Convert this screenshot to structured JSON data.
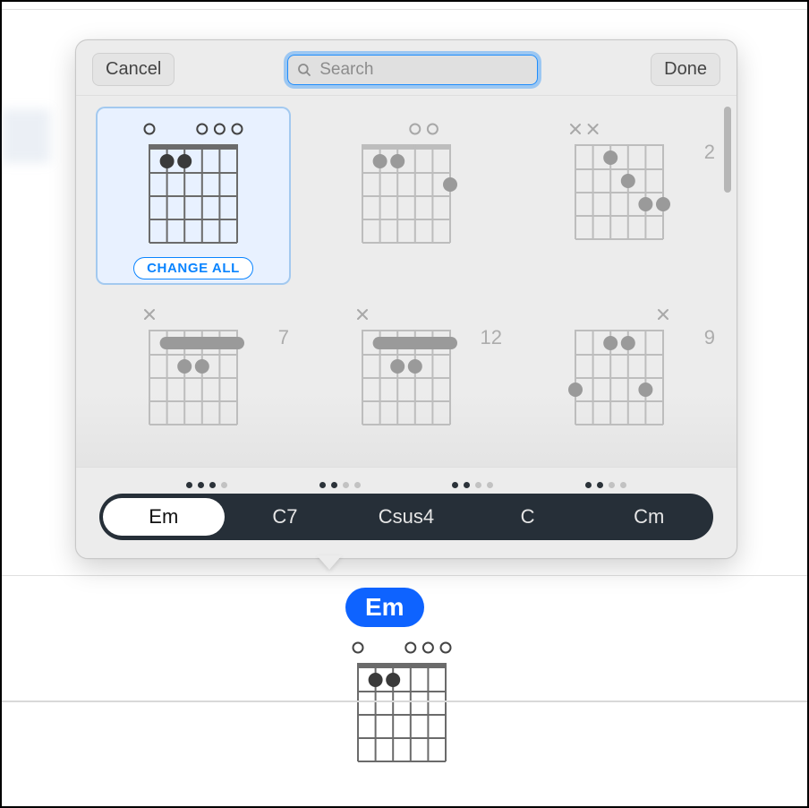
{
  "header": {
    "cancel": "Cancel",
    "done": "Done",
    "search_placeholder": "Search",
    "search_value": ""
  },
  "grid": {
    "items": [
      {
        "selected": true,
        "change_all_label": "CHANGE ALL",
        "muted": [],
        "open": [
          0,
          3,
          4,
          5
        ],
        "dots": [
          [
            1,
            1
          ],
          [
            1,
            2
          ]
        ],
        "barre": null,
        "fret_label": ""
      },
      {
        "selected": false,
        "muted": [],
        "open": [
          3,
          4
        ],
        "dots": [
          [
            1,
            1
          ],
          [
            1,
            2
          ],
          [
            2,
            5
          ]
        ],
        "barre": null,
        "fret_label": ""
      },
      {
        "selected": false,
        "muted": [
          0,
          1
        ],
        "open": [],
        "dots": [
          [
            1,
            2
          ],
          [
            2,
            3
          ],
          [
            3,
            4
          ],
          [
            3,
            5
          ]
        ],
        "barre": null,
        "fret_label": "2"
      },
      {
        "selected": false,
        "muted": [
          0
        ],
        "open": [],
        "dots": [
          [
            2,
            2
          ],
          [
            2,
            3
          ]
        ],
        "barre": {
          "fret": 1,
          "from": 1,
          "to": 5
        },
        "fret_label": "7"
      },
      {
        "selected": false,
        "muted": [
          0
        ],
        "open": [],
        "dots": [
          [
            2,
            2
          ],
          [
            2,
            3
          ]
        ],
        "barre": {
          "fret": 1,
          "from": 1,
          "to": 5
        },
        "fret_label": "12"
      },
      {
        "selected": false,
        "muted": [
          5
        ],
        "open": [],
        "dots": [
          [
            1,
            2
          ],
          [
            1,
            3
          ],
          [
            3,
            0
          ],
          [
            3,
            4
          ]
        ],
        "barre": null,
        "fret_label": "9"
      }
    ]
  },
  "segments": {
    "items": [
      {
        "label": "Em",
        "active": true,
        "dots": 4
      },
      {
        "label": "C7",
        "active": false,
        "dots": 3
      },
      {
        "label": "Csus4",
        "active": false,
        "dots": 2
      },
      {
        "label": "C",
        "active": false,
        "dots": 2
      },
      {
        "label": "Cm",
        "active": false,
        "dots": 2
      }
    ]
  },
  "doc": {
    "chip_label": "Em",
    "chord": {
      "open": [
        0,
        3,
        4,
        5
      ],
      "dots": [
        [
          1,
          1
        ],
        [
          1,
          2
        ]
      ]
    }
  }
}
